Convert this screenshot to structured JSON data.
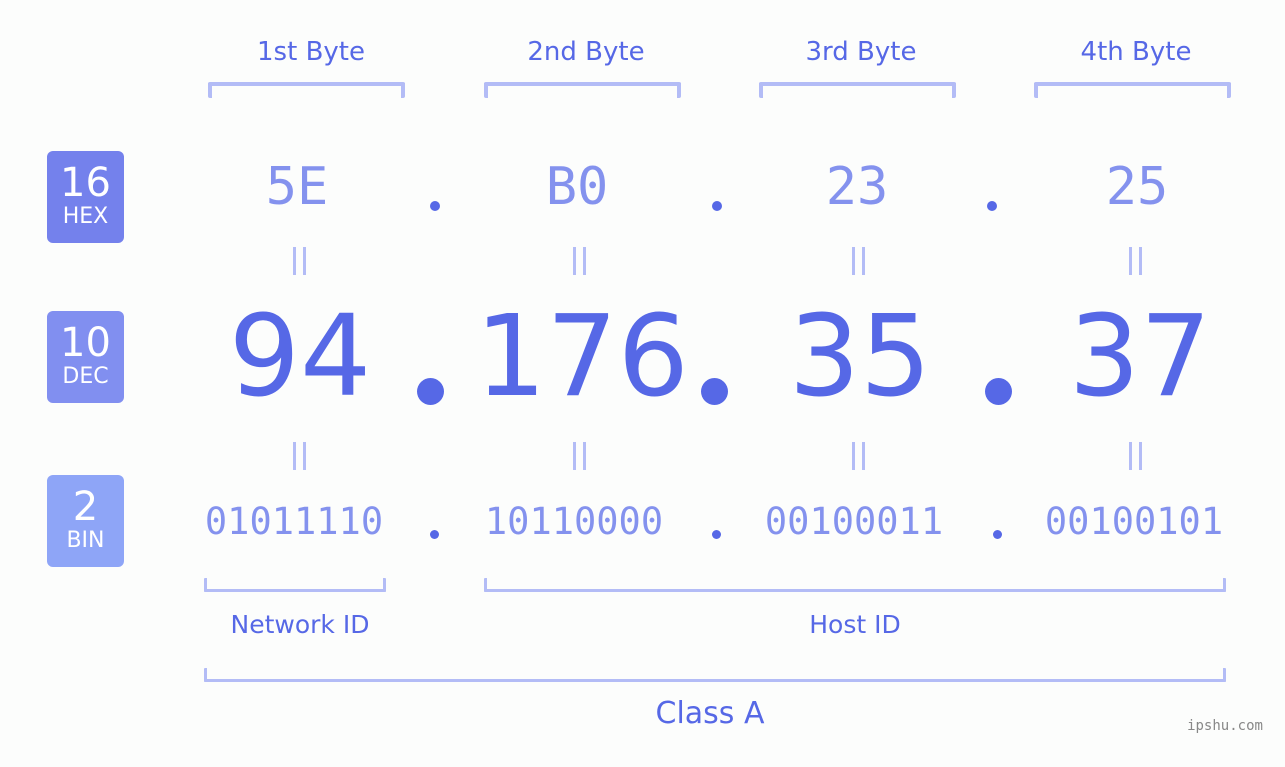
{
  "colors": {
    "accent": "#5668e6",
    "accent_light": "#8492ee",
    "bracket": "#b3bcf6",
    "badge_hex": "#7481ec",
    "badge_dec": "#818ff0",
    "badge_bin": "#8ea5f7",
    "background": "#fcfdfc"
  },
  "byte_headers": [
    "1st Byte",
    "2nd Byte",
    "3rd Byte",
    "4th Byte"
  ],
  "badges": {
    "hex": {
      "base": "16",
      "unit": "HEX"
    },
    "dec": {
      "base": "10",
      "unit": "DEC"
    },
    "bin": {
      "base": "2",
      "unit": "BIN"
    }
  },
  "ip": {
    "hex": [
      "5E",
      "B0",
      "23",
      "25"
    ],
    "dec": [
      "94",
      "176",
      "35",
      "37"
    ],
    "bin": [
      "01011110",
      "10110000",
      "00100011",
      "00100101"
    ]
  },
  "equals_symbol": "=",
  "segments": {
    "network_id": "Network ID",
    "host_id": "Host ID"
  },
  "ip_class": "Class A",
  "watermark": "ipshu.com"
}
